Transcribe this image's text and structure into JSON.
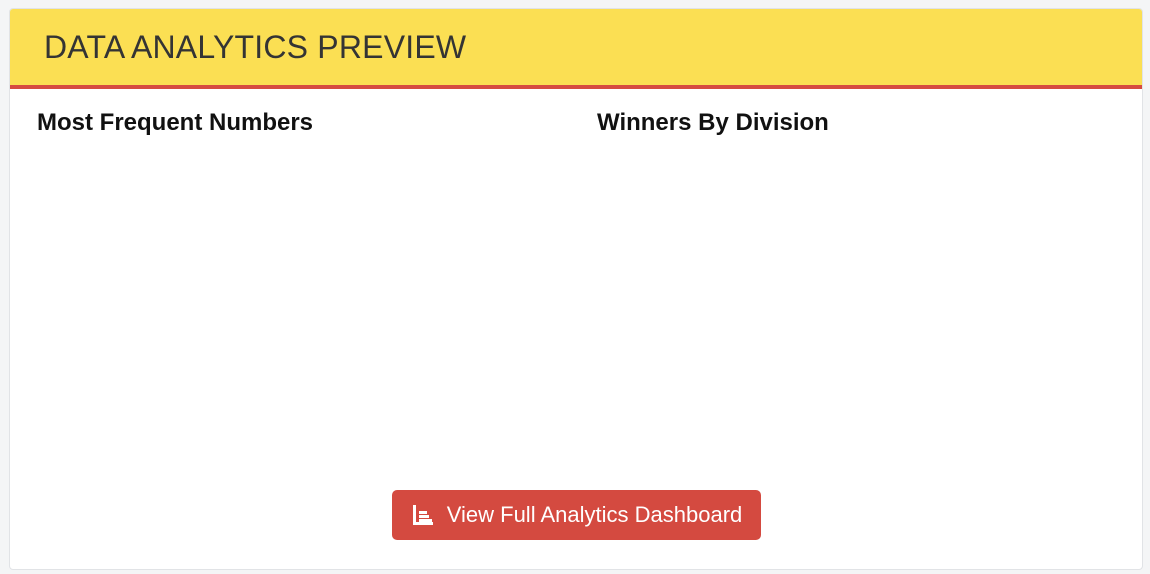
{
  "header": {
    "title": "DATA ANALYTICS PREVIEW"
  },
  "sections": {
    "left_title": "Most Frequent Numbers",
    "right_title": "Winners By Division"
  },
  "cta": {
    "label": "View Full Analytics Dashboard",
    "icon": "chart-bar-icon"
  },
  "colors": {
    "header_bg": "#fbdf53",
    "header_border": "#d64b40",
    "button_bg": "#d44a40"
  }
}
